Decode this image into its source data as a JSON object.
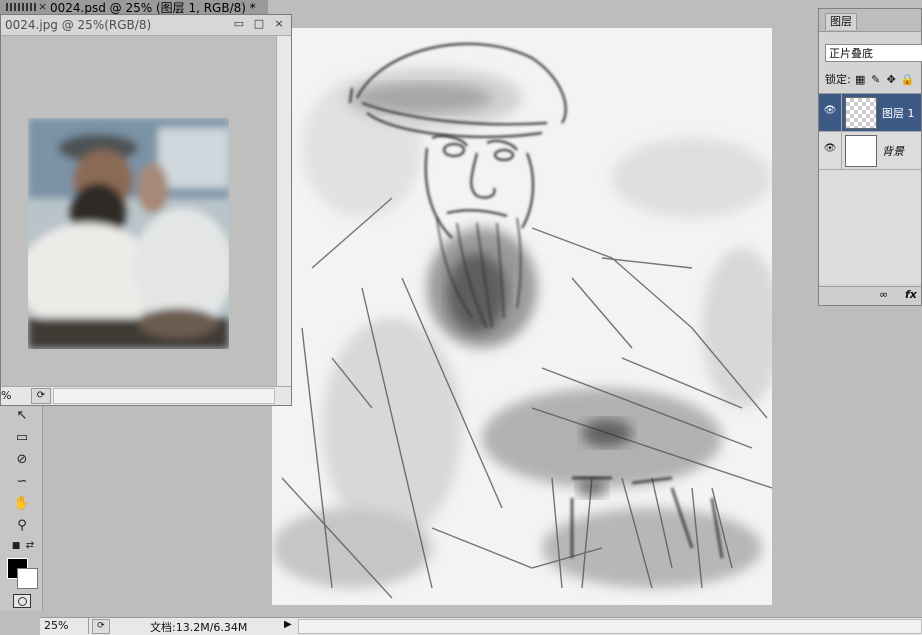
{
  "main_document": {
    "close_glyph": "×",
    "title": "0024.psd @ 25% (图层 1, RGB/8) *"
  },
  "secondary_document": {
    "title": "0024.jpg @ 25%(RGB/8)",
    "minimize_glyph": "▭",
    "maximize_glyph": "□",
    "close_glyph": "×",
    "zoom": "%"
  },
  "status_bar": {
    "zoom": "25%",
    "doc_info": "文档:13.2M/6.34M",
    "arrow_glyph": "▶"
  },
  "toolbox": {
    "tools": [
      {
        "name": "move-tool",
        "glyph": "↖"
      },
      {
        "name": "marquee-tool",
        "glyph": "▭"
      },
      {
        "name": "quick-select-tool",
        "glyph": "⊘"
      },
      {
        "name": "lasso-tool",
        "glyph": "∽"
      },
      {
        "name": "hand-tool",
        "glyph": "✋"
      },
      {
        "name": "zoom-tool",
        "glyph": "⚲"
      }
    ],
    "colors": {
      "foreground": "#000000",
      "background": "#ffffff"
    }
  },
  "layers_panel": {
    "tab": "图层",
    "blend_mode": "正片叠底",
    "lock_label": "锁定:",
    "lock_icons": [
      "▦",
      "✎",
      "✥",
      "🔒"
    ],
    "layers": [
      {
        "name": "图层 1",
        "selected": true,
        "visible": true
      },
      {
        "name": "背景",
        "selected": false,
        "visible": true
      }
    ],
    "bottom_icons": {
      "link": "∞",
      "fx": "fx"
    }
  },
  "colors": {
    "selection": "#3d5a86",
    "workspace": "#bdbdbd"
  }
}
